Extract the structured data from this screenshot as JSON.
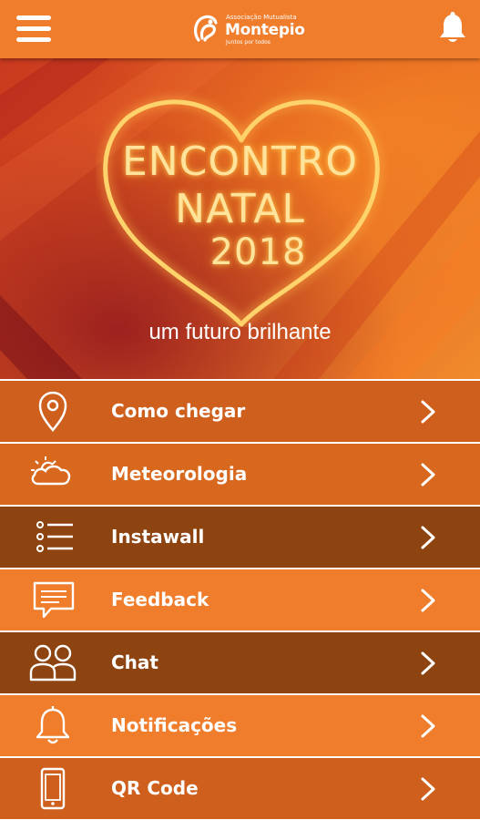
{
  "header": {
    "logo": {
      "small_text": "Associação Mutualista",
      "name": "Montepio",
      "tagline": "Juntos por todos"
    },
    "menu_icon": "hamburger-icon",
    "notification_icon": "bell-icon",
    "bar_color": "#ef7d2c"
  },
  "hero": {
    "event_title_line1": "ENCONTRO",
    "event_title_line2": "NATAL",
    "event_title_line3": "2018",
    "subtitle": "um futuro brilhante"
  },
  "menu": [
    {
      "label": "Como chegar",
      "icon": "location-pin-icon",
      "color": "#cf5f1d"
    },
    {
      "label": "Meteorologia",
      "icon": "weather-icon",
      "color": "#d9681f"
    },
    {
      "label": "Instawall",
      "icon": "list-icon",
      "color": "#8e4411"
    },
    {
      "label": "Feedback",
      "icon": "chat-bubble-icon",
      "color": "#ef7d2c"
    },
    {
      "label": "Chat",
      "icon": "users-icon",
      "color": "#8e4411"
    },
    {
      "label": "Notificações",
      "icon": "bell-icon",
      "color": "#ef7d2c"
    },
    {
      "label": "QR Code",
      "icon": "phone-icon",
      "color": "#cf5f1d"
    }
  ]
}
